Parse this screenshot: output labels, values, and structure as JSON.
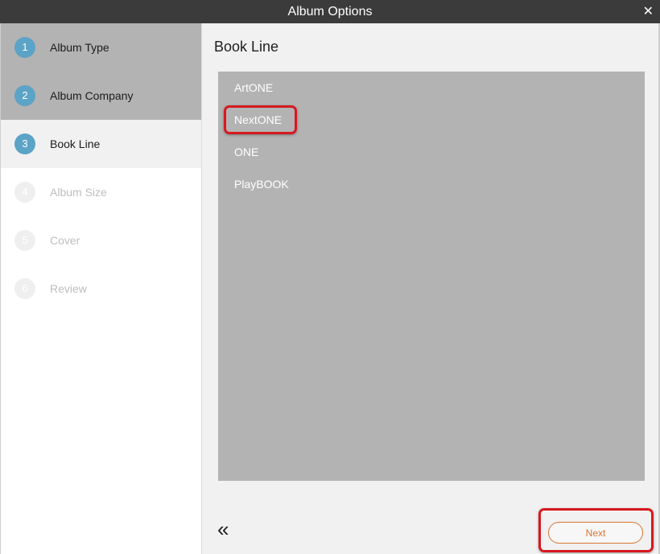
{
  "window": {
    "title": "Album Options",
    "close_glyph": "✕"
  },
  "sidebar": {
    "steps": [
      {
        "number": "1",
        "label": "Album Type",
        "state": "done"
      },
      {
        "number": "2",
        "label": "Album Company",
        "state": "done"
      },
      {
        "number": "3",
        "label": "Book Line",
        "state": "current"
      },
      {
        "number": "4",
        "label": "Album Size",
        "state": "pending"
      },
      {
        "number": "5",
        "label": "Cover",
        "state": "pending"
      },
      {
        "number": "6",
        "label": "Review",
        "state": "pending"
      }
    ]
  },
  "main": {
    "title": "Book Line",
    "options": [
      {
        "label": "ArtONE"
      },
      {
        "label": "NextONE",
        "highlighted": true
      },
      {
        "label": "ONE"
      },
      {
        "label": "PlayBOOK"
      }
    ]
  },
  "footer": {
    "back_glyph": "«",
    "next_label": "Next"
  },
  "colors": {
    "titlebar": "#3b3b3b",
    "step_circle": "#5ba3c7",
    "list_bg": "#b3b3b3",
    "accent": "#d9732e",
    "highlight": "#d6191f"
  }
}
